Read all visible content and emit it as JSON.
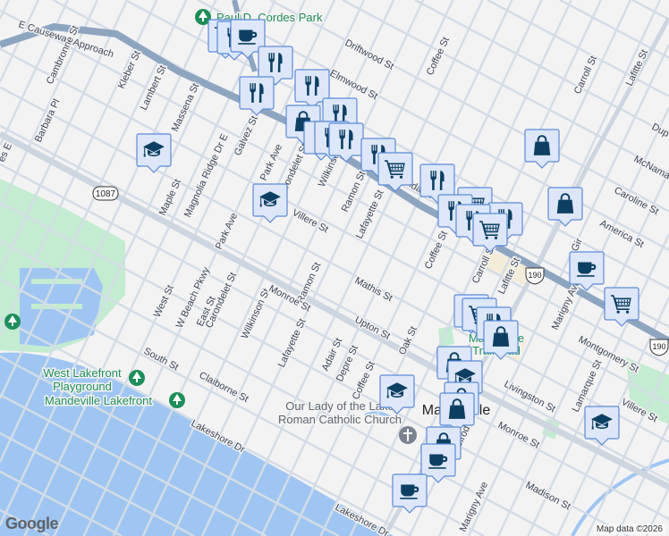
{
  "colors": {
    "background": "#f4f3f4",
    "water": "#9fc6f2",
    "park": "#c3ecd1",
    "highway": "#8ea5c0",
    "street": "#d4dce6",
    "marker_fill": "#dde7f9",
    "marker_stroke": "#5a8ad8",
    "marker_icon": "#0d3f63",
    "park_text": "#1e8e5a"
  },
  "icons": {
    "restaurant": "fork-knife-icon",
    "coffee": "coffee-cup-icon",
    "cart": "shopping-cart-icon",
    "bag": "shopping-bag-icon",
    "school": "graduation-cap-icon",
    "park": "tree-icon",
    "church": "cross-icon"
  },
  "places": {
    "cordes_park": "Paul D. Cordes Park",
    "west_lakefront_1": "West Lakefront",
    "west_lakefront_2": "Playground",
    "mandeville_lakefront": "Mandeville Lakefront",
    "church_1": "Our Lady of the Lake",
    "church_2": "Roman Catholic Church",
    "city": "Mandeville",
    "trailhead_1": "Mandeville",
    "trailhead_2": "Trailhead"
  },
  "shields": {
    "route_1087": "1087",
    "us_190_a": "190",
    "us_190_b": "190"
  },
  "streets": {
    "causeway": "E Causeway Approach",
    "cambronne": "Cambronne St",
    "barbara": "Barbara Pl",
    "kleber": "Kleber St",
    "lambert": "Lambert St",
    "massena": "Massena St",
    "maple": "Maple St",
    "magnolia": "Magnolia Ridge Dr E",
    "galvez": "Galvez St",
    "park_ave_1": "Park Ave",
    "park_ave_2": "Park Ave",
    "carondelet_1": "Carondelet St",
    "carondelet_2": "Carondelet St",
    "villere_1": "Villere St",
    "villere_2": "Villere St",
    "wilkinson_1": "Wilkinson St",
    "wilkinson_2": "Wilkinson St",
    "ramon_1": "Ramon St",
    "ramon_2": "Ramon St",
    "lafayette_1": "Lafayette St",
    "lafayette_2": "Lafayette St",
    "driftwood": "Driftwood St",
    "elmwood": "Elmwood St",
    "florida": "Florida St",
    "coffee_1": "Coffee St",
    "coffee_2": "Coffee St",
    "coffee_3": "Coffee St",
    "carroll_1": "Carroll St",
    "carroll_2": "Carroll St",
    "lafitte_1": "Lafitte St",
    "lafitte_2": "Lafitte St",
    "dupre": "Dup",
    "mcnamara": "McNama",
    "caroline": "Caroline St",
    "america": "America St",
    "girod_1": "Gir",
    "girod_2": "Girod St",
    "mathis": "Mathis St",
    "upton": "Upton St",
    "oak": "Oak St",
    "adair": "Adair St",
    "depre": "Depre St",
    "marigny_1": "Marigny Ave",
    "marigny_2": "Marigny Ave",
    "montgomery": "Montgomery St",
    "lamarque": "Lamarque St",
    "livingston": "Livingston St",
    "monroe_1": "Monroe St",
    "monroe_2": "Monroe St",
    "madison": "Madison St",
    "lakeshore_1": "Lakeshore Dr",
    "lakeshore_2": "Lakeshore Dr",
    "claiborne": "Claiborne St",
    "south": "South St",
    "west": "West St",
    "wbeach": "W Beach Pkwy",
    "east": "East St",
    "partial_w": "es E"
  },
  "footer": {
    "logo": "Google",
    "attribution": "Map data ©2026"
  }
}
